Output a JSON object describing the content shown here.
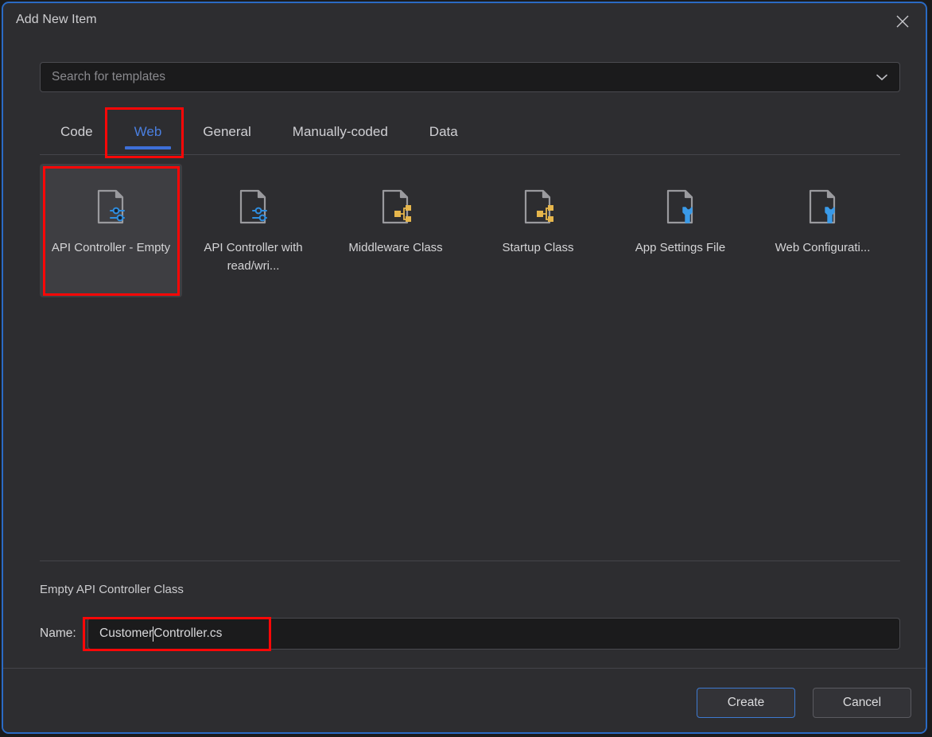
{
  "dialog": {
    "title": "Add New Item",
    "close_icon": "close-icon",
    "accent_color": "#2a6ac4",
    "background_color": "#2d2d30",
    "annotation_color": "#fb0707"
  },
  "search": {
    "placeholder": "Search for templates",
    "value": "",
    "chevron_icon": "chevron-down-icon"
  },
  "tabs": [
    {
      "label": "Code",
      "active": false
    },
    {
      "label": "Web",
      "active": true
    },
    {
      "label": "General",
      "active": false
    },
    {
      "label": "Manually-coded",
      "active": false
    },
    {
      "label": "Data",
      "active": false
    }
  ],
  "templates": [
    {
      "label": "API Controller - Empty",
      "icon": "document-api-icon",
      "icon_color": "#2f8ee0",
      "selected": true
    },
    {
      "label": "API Controller with read/wri...",
      "icon": "document-api-icon",
      "icon_color": "#2f8ee0",
      "selected": false
    },
    {
      "label": "Middleware Class",
      "icon": "document-class-icon",
      "icon_color": "#e6b64c",
      "selected": false
    },
    {
      "label": "Startup Class",
      "icon": "document-class-icon",
      "icon_color": "#e6b64c",
      "selected": false
    },
    {
      "label": "App Settings File",
      "icon": "document-wrench-icon",
      "icon_color": "#3a9ae8",
      "selected": false
    },
    {
      "label": "Web Configurati...",
      "icon": "document-wrench-icon",
      "icon_color": "#3a9ae8",
      "selected": false
    }
  ],
  "description": "Empty API Controller Class",
  "name_field": {
    "label": "Name:",
    "value_before_caret": "Customer",
    "value_after_caret": "Controller.cs"
  },
  "footer": {
    "create_label": "Create",
    "cancel_label": "Cancel"
  }
}
